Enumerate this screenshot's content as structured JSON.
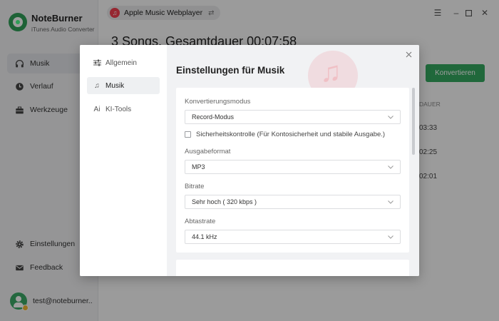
{
  "app": {
    "name": "NoteBurner",
    "subtitle": "iTunes Audio Converter"
  },
  "sidebar": {
    "items": [
      {
        "label": "Musik",
        "icon": "headphones-icon",
        "active": true
      },
      {
        "label": "Verlauf",
        "icon": "clock-icon"
      },
      {
        "label": "Werkzeuge",
        "icon": "toolbox-icon"
      }
    ],
    "bottom": [
      {
        "label": "Einstellungen",
        "icon": "gear-icon"
      },
      {
        "label": "Feedback",
        "icon": "mail-icon"
      }
    ],
    "user_email": "test@noteburner..."
  },
  "topbar": {
    "source_label": "Apple Music Webplayer"
  },
  "main": {
    "title": "3 Songs, Gesamtdauer 00:07:58",
    "convert_label": "Konvertieren",
    "duration_header": "DAUER",
    "durations": [
      "03:33",
      "02:25",
      "02:01"
    ]
  },
  "dialog": {
    "nav": [
      {
        "label": "Allgemein",
        "icon": "sliders-icon"
      },
      {
        "label": "Musik",
        "icon": "music-note-icon",
        "active": true
      },
      {
        "label": "KI-Tools",
        "icon": "ai-icon"
      }
    ],
    "title": "Einstellungen für Musik",
    "fields": {
      "mode_label": "Konvertierungsmodus",
      "mode_value": "Record-Modus",
      "safety_check": "Sicherheitskontrolle (Für Kontosicherheit und stabile Ausgabe.)",
      "format_label": "Ausgabeformat",
      "format_value": "MP3",
      "bitrate_label": "Bitrate",
      "bitrate_value": "Sehr hoch ( 320 kbps )",
      "samplerate_label": "Abtastrate",
      "samplerate_value": "44.1 kHz"
    }
  },
  "colors": {
    "accent": "#35a85f",
    "music_red": "#f2404f"
  }
}
